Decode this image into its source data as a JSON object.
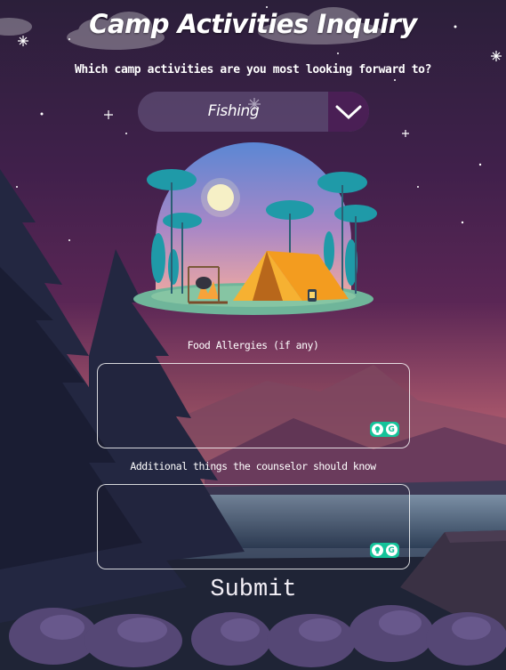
{
  "form": {
    "title": "Camp Activities Inquiry",
    "question": "Which camp activities are you most looking forward to?",
    "activity_select": {
      "selected": "Fishing",
      "arrow_icon": "chevron-down-icon"
    },
    "food_allergies": {
      "label": "Food Allergies (if any)",
      "value": ""
    },
    "counselor_notes": {
      "label": "Additional things the counselor should know",
      "value": ""
    },
    "submit_label": "Submit"
  },
  "grammarly_icon": "grammarly-icon",
  "colors": {
    "sky_top": "#2b1f3a",
    "sky_mid": "#4b2252",
    "sky_horizon": "#d2826b",
    "select_arrow_bg": "#4a1f55",
    "badge": "#15c39a"
  }
}
